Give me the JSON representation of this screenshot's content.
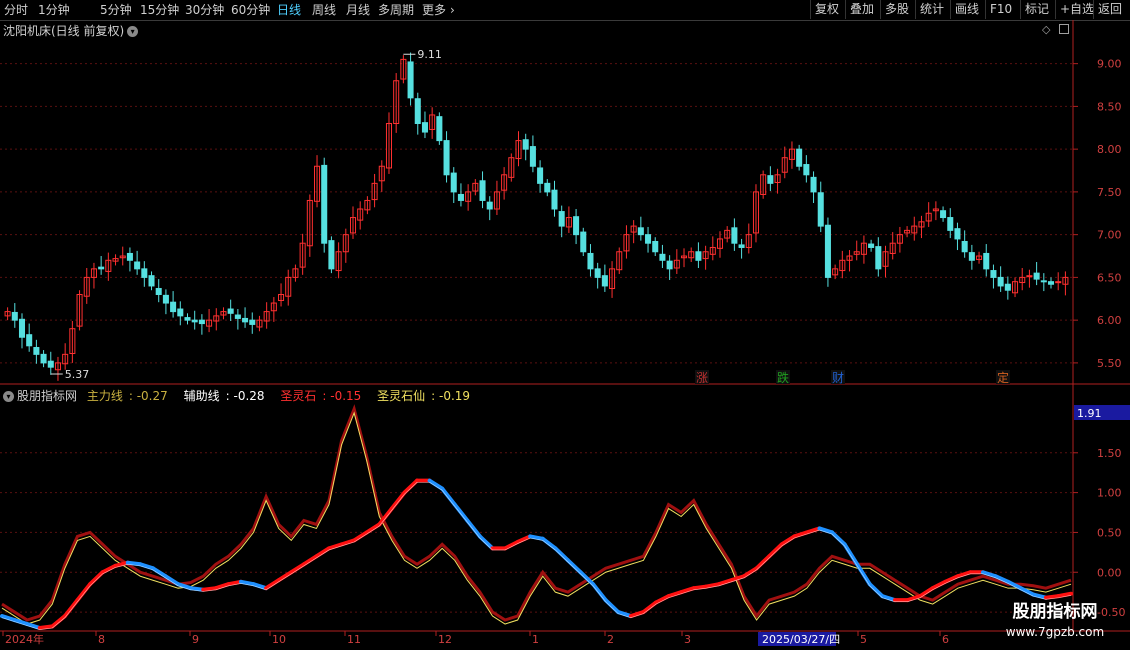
{
  "toolbar": {
    "periods": [
      "分时",
      "1分钟",
      "5分钟",
      "15分钟",
      "30分钟",
      "60分钟",
      "日线",
      "周线",
      "月线",
      "多周期",
      "更多"
    ],
    "active_period": "日线",
    "more_arrow": "›",
    "right_buttons": [
      "复权",
      "叠加",
      "多股",
      "统计",
      "画线",
      "F10",
      "标记",
      "+自选",
      "返回"
    ]
  },
  "chart_header": {
    "title": "沈阳机床(日线 前复权)",
    "dropdown_icon": "chevron-down-icon"
  },
  "colors": {
    "bg": "#000000",
    "grid": "#5a1010",
    "axis": "#b02020",
    "up": "#ff3030",
    "down": "#56e0e0",
    "white_line": "#ffffff",
    "yellow_line": "#f0e060",
    "red_line": "#ff1010",
    "blue_line": "#1e90ff"
  },
  "chart_data": [
    {
      "type": "candlestick",
      "title": "沈阳机床(日线 前复权)",
      "yticks": [
        "9.00",
        "8.50",
        "8.00",
        "7.50",
        "7.00",
        "6.50",
        "6.00",
        "5.50"
      ],
      "ylim": [
        5.3,
        9.3
      ],
      "annotations": {
        "high": "9.11",
        "low": "5.37"
      },
      "markers": [
        "涨",
        "跌",
        "财",
        "定"
      ],
      "close_series": [
        6.1,
        6.0,
        5.8,
        5.7,
        5.6,
        5.5,
        5.45,
        5.5,
        5.6,
        5.9,
        6.3,
        6.5,
        6.6,
        6.6,
        6.7,
        6.72,
        6.75,
        6.7,
        6.6,
        6.5,
        6.4,
        6.3,
        6.2,
        6.1,
        6.05,
        6.0,
        5.98,
        5.96,
        6.0,
        6.05,
        6.1,
        6.08,
        6.02,
        5.98,
        5.95,
        6.0,
        6.1,
        6.2,
        6.3,
        6.5,
        6.6,
        6.9,
        7.4,
        7.8,
        6.9,
        6.6,
        6.8,
        7.0,
        7.2,
        7.3,
        7.4,
        7.6,
        7.8,
        8.3,
        8.8,
        9.05,
        8.6,
        8.3,
        8.2,
        8.4,
        8.1,
        7.7,
        7.5,
        7.4,
        7.5,
        7.6,
        7.4,
        7.3,
        7.5,
        7.7,
        7.9,
        8.1,
        8.0,
        7.8,
        7.6,
        7.5,
        7.3,
        7.1,
        7.2,
        7.0,
        6.8,
        6.6,
        6.5,
        6.4,
        6.6,
        6.8,
        7.0,
        7.1,
        7.0,
        6.9,
        6.8,
        6.7,
        6.6,
        6.7,
        6.75,
        6.8,
        6.7,
        6.8,
        6.85,
        6.95,
        7.05,
        6.9,
        6.85,
        7.0,
        7.5,
        7.7,
        7.6,
        7.7,
        7.9,
        8.0,
        7.8,
        7.7,
        7.5,
        7.1,
        6.5,
        6.6,
        6.7,
        6.75,
        6.8,
        6.9,
        6.85,
        6.6,
        6.8,
        6.9,
        7.0,
        7.05,
        7.1,
        7.15,
        7.25,
        7.3,
        7.2,
        7.05,
        6.95,
        6.8,
        6.7,
        6.75,
        6.6,
        6.5,
        6.4,
        6.35,
        6.45,
        6.5,
        6.52,
        6.48,
        6.45,
        6.42,
        6.45,
        6.5
      ]
    },
    {
      "type": "line",
      "title": "股朋指标网",
      "series": [
        {
          "name": "主力线",
          "value": "-0.27"
        },
        {
          "name": "辅助线",
          "value": "-0.28"
        },
        {
          "name": "圣灵石",
          "value": "-0.15"
        },
        {
          "name": "圣灵石仙",
          "value": "-0.19"
        }
      ],
      "yticks": [
        "1.50",
        "1.00",
        "0.50",
        "0.00",
        "-0.50"
      ],
      "ylim": [
        -0.7,
        2.1
      ],
      "current_value": "1.91",
      "x_labels": [
        "2024年",
        "8",
        "9",
        "10",
        "11",
        "12",
        "1",
        "2",
        "3",
        "2025/03/27/四",
        "5",
        "6"
      ],
      "main_series": [
        -0.55,
        -0.6,
        -0.65,
        -0.7,
        -0.68,
        -0.55,
        -0.35,
        -0.15,
        0.0,
        0.08,
        0.12,
        0.1,
        0.05,
        -0.05,
        -0.15,
        -0.2,
        -0.22,
        -0.2,
        -0.15,
        -0.12,
        -0.15,
        -0.2,
        -0.1,
        0.0,
        0.1,
        0.2,
        0.3,
        0.35,
        0.4,
        0.5,
        0.6,
        0.8,
        1.0,
        1.15,
        1.15,
        1.05,
        0.85,
        0.65,
        0.45,
        0.3,
        0.3,
        0.38,
        0.45,
        0.42,
        0.3,
        0.15,
        0.0,
        -0.15,
        -0.35,
        -0.5,
        -0.55,
        -0.5,
        -0.38,
        -0.3,
        -0.25,
        -0.2,
        -0.18,
        -0.15,
        -0.1,
        -0.05,
        0.05,
        0.2,
        0.35,
        0.45,
        0.5,
        0.55,
        0.5,
        0.35,
        0.1,
        -0.15,
        -0.3,
        -0.35,
        -0.35,
        -0.3,
        -0.2,
        -0.12,
        -0.05,
        0.0,
        0.0,
        -0.05,
        -0.12,
        -0.2,
        -0.28,
        -0.32,
        -0.3,
        -0.27
      ],
      "aux_series": [
        -0.45,
        -0.55,
        -0.65,
        -0.6,
        -0.4,
        0.05,
        0.4,
        0.45,
        0.3,
        0.15,
        0.05,
        -0.05,
        -0.1,
        -0.15,
        -0.2,
        -0.18,
        -0.1,
        0.05,
        0.15,
        0.3,
        0.5,
        0.9,
        0.55,
        0.4,
        0.6,
        0.55,
        0.85,
        1.6,
        2.0,
        1.4,
        0.7,
        0.4,
        0.15,
        0.05,
        0.15,
        0.3,
        0.15,
        -0.1,
        -0.3,
        -0.55,
        -0.65,
        -0.6,
        -0.3,
        -0.05,
        -0.25,
        -0.3,
        -0.2,
        -0.1,
        0.0,
        0.05,
        0.1,
        0.15,
        0.45,
        0.8,
        0.7,
        0.85,
        0.55,
        0.3,
        0.05,
        -0.35,
        -0.6,
        -0.4,
        -0.35,
        -0.3,
        -0.2,
        0.0,
        0.15,
        0.1,
        0.05,
        0.05,
        -0.05,
        -0.15,
        -0.25,
        -0.35,
        -0.4,
        -0.3,
        -0.2,
        -0.15,
        -0.1,
        -0.15,
        -0.2,
        -0.2,
        -0.22,
        -0.25,
        -0.2,
        -0.15
      ]
    }
  ],
  "watermark": {
    "line1": "股朋指标网",
    "line2": "www.7gpzb.com"
  }
}
